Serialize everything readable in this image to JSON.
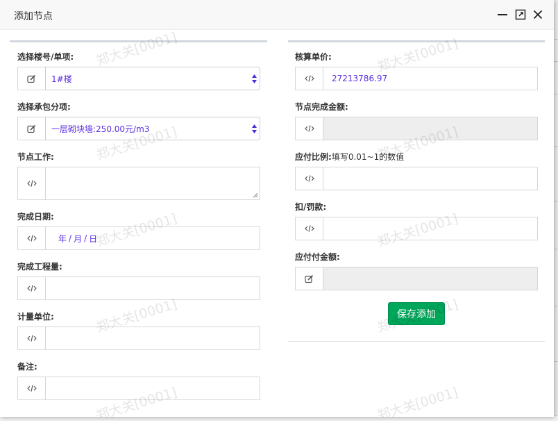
{
  "dialog": {
    "title": "添加节点"
  },
  "left": {
    "building": {
      "label": "选择楼号/单项:",
      "value": "1#楼"
    },
    "contract": {
      "label": "选择承包分项:",
      "value": "一层砌块墙:250.00元/m3"
    },
    "work": {
      "label": "节点工作:",
      "value": ""
    },
    "date": {
      "label": "完成日期:",
      "year": "年",
      "month": "月",
      "day": "日",
      "sep": "/"
    },
    "quantity": {
      "label": "完成工程量:",
      "value": ""
    },
    "unit": {
      "label": "计量单位:",
      "value": ""
    },
    "remark": {
      "label": "备注:",
      "value": ""
    }
  },
  "right": {
    "unit_price": {
      "label": "核算单价:",
      "value": "27213786.97"
    },
    "node_amount": {
      "label": "节点完成金额:",
      "value": ""
    },
    "pay_ratio": {
      "label": "应付比例:",
      "hint": "填写0.01~1的数值",
      "value": ""
    },
    "deduction": {
      "label": "扣/罚款:",
      "value": ""
    },
    "payable": {
      "label": "应付付金额:",
      "value": ""
    },
    "save_label": "保存添加"
  },
  "watermark": "郑大关[0001]",
  "icons": {
    "edit": "edit-icon",
    "code": "code-icon",
    "minimize": "minimize-icon",
    "maximize": "maximize-icon",
    "close": "close-icon"
  }
}
